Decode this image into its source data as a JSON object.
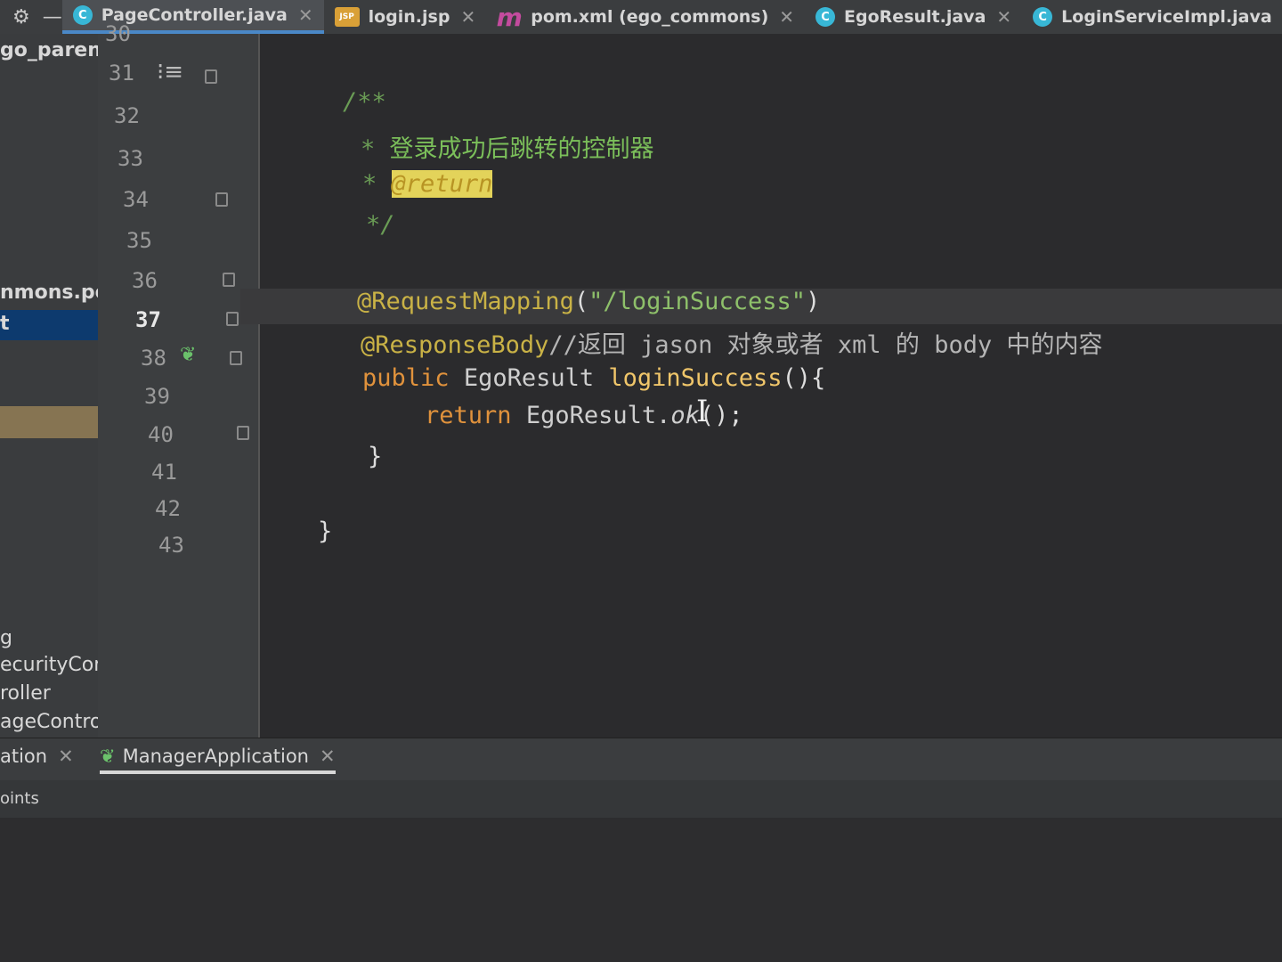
{
  "tabs": [
    {
      "label": "PageController.java",
      "icon": "class-icon",
      "active": true
    },
    {
      "label": "login.jsp",
      "icon": "jsp-icon",
      "active": false
    },
    {
      "label": "pom.xml (ego_commons)",
      "icon": "maven-icon",
      "active": false
    },
    {
      "label": "EgoResult.java",
      "icon": "class-icon",
      "active": false
    },
    {
      "label": "LoginServiceImpl.java",
      "icon": "class-icon",
      "active": false
    }
  ],
  "project": {
    "items": [
      "go_paren",
      "nmons.pojo",
      "t",
      "g",
      "ecurityConfig",
      "roller",
      "ageController",
      "ation",
      "oints"
    ]
  },
  "gutter": {
    "line_numbers": [
      "30",
      "31",
      "32",
      "33",
      "34",
      "35",
      "36",
      "37",
      "38",
      "39",
      "40",
      "41",
      "42",
      "43"
    ]
  },
  "code": {
    "l31": "/**",
    "l32_star": "* ",
    "l32_text": "登录成功后跳转的控制器",
    "l33_star": "* ",
    "l33_tag": "@return",
    "l34": "*/",
    "l36_anno": "@RequestMapping",
    "l36_open": "(",
    "l36_str": "\"/loginSuccess\"",
    "l36_close": ")",
    "l37_anno": "@ResponseBody",
    "l37_cmt": "//返回 jason 对象或者 xml 的 body 中的内容",
    "l38_kw": "public ",
    "l38_type": "EgoResult ",
    "l38_fn": "loginSuccess",
    "l38_rest": "(){",
    "l39_kw": "return ",
    "l39_type": "EgoResult.",
    "l39_fn": "ok",
    "l39_rest": "();",
    "l40": "}",
    "l42": "}"
  },
  "runbar": {
    "tab1": "ation",
    "tab2": "ManagerApplication"
  },
  "subbar": {
    "label": "oints"
  }
}
